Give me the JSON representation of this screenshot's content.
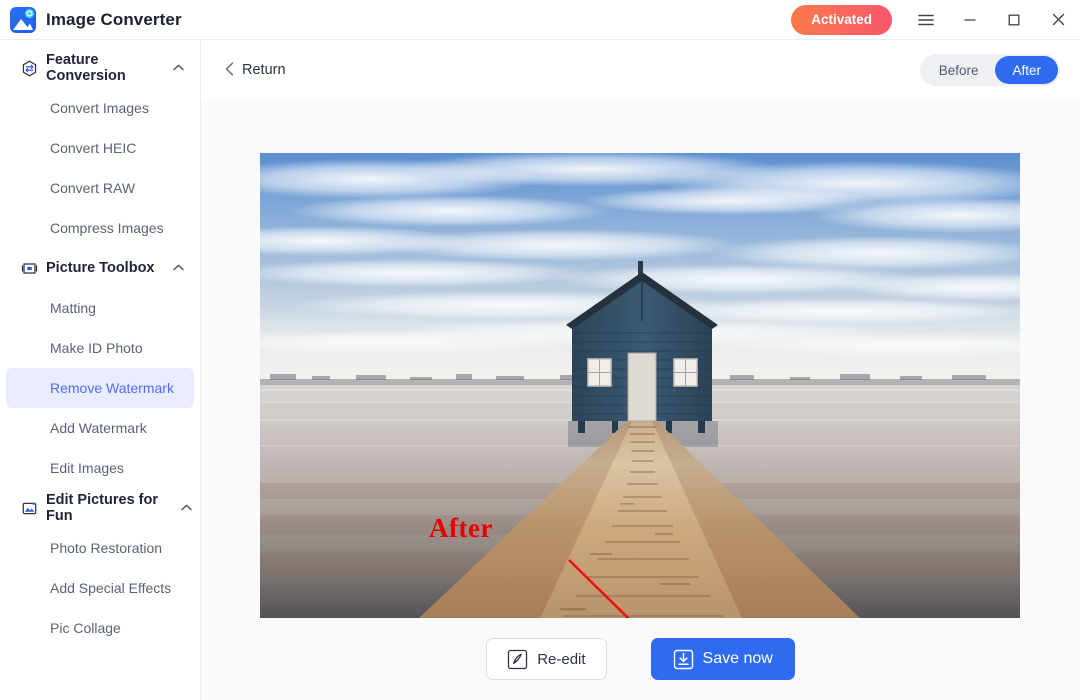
{
  "window": {
    "app_title": "Image Converter",
    "logo_icon": "image-converter-logo",
    "activated_label": "Activated",
    "menu_icon": "hamburger-menu-icon",
    "minimize_icon": "minimize-icon",
    "maximize_icon": "maximize-icon",
    "close_icon": "close-icon"
  },
  "sidebar": {
    "groups": [
      {
        "label": "Feature Conversion",
        "icon": "convert-hexagon-icon",
        "chevron": "chevron-up-icon",
        "expanded": true,
        "items": [
          {
            "label": "Convert Images",
            "active": false
          },
          {
            "label": "Convert HEIC",
            "active": false
          },
          {
            "label": "Convert RAW",
            "active": false
          },
          {
            "label": "Compress Images",
            "active": false
          }
        ]
      },
      {
        "label": "Picture Toolbox",
        "icon": "toolbox-icon",
        "chevron": "chevron-up-icon",
        "expanded": true,
        "items": [
          {
            "label": "Matting",
            "active": false
          },
          {
            "label": "Make ID Photo",
            "active": false
          },
          {
            "label": "Remove Watermark",
            "active": true
          },
          {
            "label": "Add Watermark",
            "active": false
          },
          {
            "label": "Edit Images",
            "active": false
          }
        ]
      },
      {
        "label": "Edit Pictures for Fun",
        "icon": "photo-sparkle-icon",
        "chevron": "chevron-up-icon",
        "expanded": true,
        "items": [
          {
            "label": "Photo Restoration",
            "active": false
          },
          {
            "label": "Add Special Effects",
            "active": false
          },
          {
            "label": "Pic Collage",
            "active": false
          }
        ]
      }
    ]
  },
  "toolbar": {
    "return_label": "Return",
    "return_icon": "chevron-left-icon",
    "before_label": "Before",
    "after_label": "After",
    "active_view": "After"
  },
  "canvas": {
    "annotation_text": "After",
    "annotation_color": "#e60000",
    "arrow_icon": "red-arrow-annotation",
    "photo_description": "Blue boathouse at the end of a wooden jetty over calm water under a cloudy blue sky"
  },
  "bottom": {
    "reedit_label": "Re-edit",
    "reedit_icon": "pen-edit-icon",
    "save_label": "Save now",
    "save_icon": "download-save-icon"
  },
  "colors": {
    "accent_blue": "#2f6bf0",
    "active_item_bg": "#e8ecfd",
    "active_item_text": "#4e6ef2",
    "activated_gradient_start": "#fb7b4b",
    "activated_gradient_end": "#f8566b",
    "annotation_red": "#e60000"
  }
}
